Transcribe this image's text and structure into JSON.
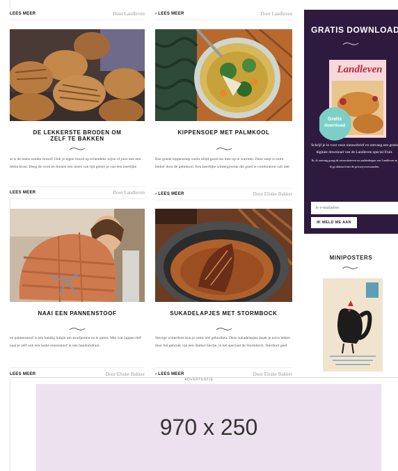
{
  "cards": [
    {
      "top_link": "LEES MEER",
      "top_author": "Door Landleven",
      "title": "DE LEKKERSTE BRODEN OM ZELF TE BAKKEN",
      "excerpt": "at is de mens zonder brood? Ook je eigen brood op ertiendeke wijze of juist met een lekke brost. Deeg de oven en binnen een moes van tijd geniet je van een heerlijke",
      "bottom_link": "LEES MEER",
      "bottom_author": "Door Landleven"
    },
    {
      "top_link": "› LEES MEER",
      "top_author": "Door Landleven",
      "title": "KIPPENSOEP MET PALMKOOL",
      "excerpt": "Een goede kippensoep werkt altijd goed om mee op te warmen. Deze soep is extra lekker door de palmkool. Een heerlijke wintergroente die goed te combineren valt met",
      "bottom_link": "› LEES MEER",
      "bottom_author": "Door Elsske Bakker"
    },
    {
      "title": "NAAI EEN PANNENSTOOF",
      "excerpt": "en pannenstoof is een handig hulpje om stoofpotten na te garen. Met wat lappen stof naai je zelf ook een leuke ennenstoof in een handomdraai.",
      "bottom_link": "LEES MEER",
      "bottom_author": "Door Elsske Bakker"
    },
    {
      "title": "SUKADELAPJES MET STORMBOCK",
      "excerpt": "Stevige winterkost kun je soms wel gebruiken. Deze sukadelapjes maak je extra lekker door het gebruik van een donker biertje, in het speciaal de Stormbock. Hierdoor geef",
      "bottom_link": "› LEES MEER",
      "bottom_author": "Door Elsske Bakker"
    }
  ],
  "newsletter": {
    "title": "GRATIS DOWNLOAD",
    "cover_brand": "Landleven",
    "cover_badge_line1": "Gratis",
    "cover_badge_line2": "download",
    "text": "Schrijf je in voor onze nieuwsbrief en ontvang een gratis digitale download van de Landleven special Fruit.",
    "fineprint": "Ik, ik ontvang graag de nieuwsbrieven en aanbiedingen van Landleven en ik ga akkoord met de privacyvoorwaarden.",
    "input_placeholder": "Je e-mailadres",
    "button_label": "IK MELD ME AAN"
  },
  "miniposters": {
    "title": "MINIPOSTERS"
  },
  "advert": {
    "label": "ADVERTENTIE",
    "size_text": "970 x 250",
    "bg_color": "#eee1ef"
  },
  "colors": {
    "newsletter_bg": "#2e1a3f",
    "text_dark": "#111111",
    "meta_gray": "#9a9a9a"
  }
}
